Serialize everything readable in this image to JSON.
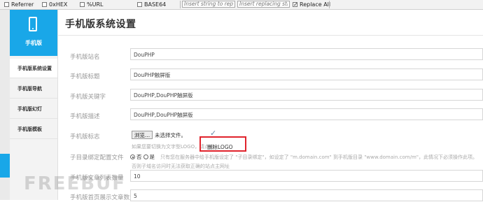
{
  "toolbar": {
    "referrer": "Referrer",
    "hex": "0xHEX",
    "url": "%URL",
    "base64": "BASE64",
    "insert_placeholder": "Insert string to replace",
    "replacing_placeholder": "Insert replacing string",
    "replace_all": "Replace All"
  },
  "sidebar": {
    "header_label": "手机版",
    "items": [
      {
        "label": "手机版系统设置"
      },
      {
        "label": "手机版导航"
      },
      {
        "label": "手机版幻灯"
      },
      {
        "label": "手机版模板"
      }
    ]
  },
  "main": {
    "title": "手机版系统设置",
    "fields": [
      {
        "label": "手机版站名",
        "value": "DouPHP"
      },
      {
        "label": "手机版标题",
        "value": "DouPHP触屏版"
      },
      {
        "label": "手机版关键字",
        "value": "DouPHP,DouPHP触屏版"
      },
      {
        "label": "手机版描述",
        "value": "DouPHP,DouPHP触屏版"
      }
    ],
    "logo": {
      "label": "手机版标志",
      "browse_button": "浏览...",
      "no_file": "未选择文件。",
      "hint": "如果您要切换为文字型LOGO，请点击",
      "delete_logo": "删除LOGO"
    },
    "subdir": {
      "label": "子目录绑定配置文件",
      "option_no": "否",
      "option_yes": "是",
      "hint": "只有您在服务器中给手机版设定了 \"子目录绑定\"，如设定了 \"m.domain.com\" 到手机版目录 \"www.domain.com/m\"，此情况下必须操作此项。",
      "hint2": "否则子域名访问时无法获取正确的站点主网址"
    },
    "list_count": {
      "label": "手机版文章列表数量",
      "value": "10"
    },
    "home_count": {
      "label": "手机版首页展示文章数量",
      "value": "5"
    }
  },
  "watermark": "FREEBUF"
}
